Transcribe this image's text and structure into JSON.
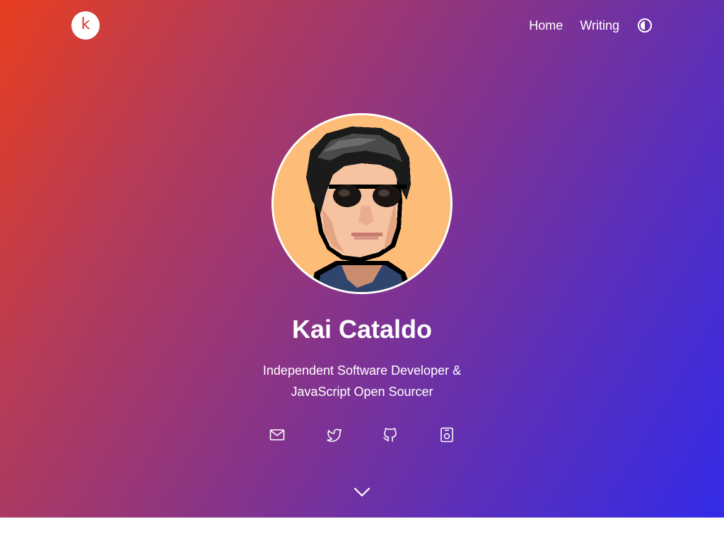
{
  "header": {
    "logo_text": "k",
    "nav": [
      {
        "label": "Home"
      },
      {
        "label": "Writing"
      }
    ],
    "theme_toggle_icon": "half-circle-contrast-icon"
  },
  "profile": {
    "name": "Kai Cataldo",
    "tagline_line1": "Independent Software Developer &",
    "tagline_line2": "JavaScript Open Sourcer",
    "avatar_description": "pixel-art-portrait"
  },
  "socials": [
    {
      "icon": "mail-icon"
    },
    {
      "icon": "twitter-icon"
    },
    {
      "icon": "github-icon"
    },
    {
      "icon": "resume-icon"
    }
  ],
  "scroll_icon": "chevron-down-icon",
  "colors": {
    "gradient_start": "#e83e1e",
    "gradient_mid": "#8b3485",
    "gradient_end": "#332be8",
    "avatar_bg": "#fdbd78",
    "logo_letter": "#d8392b"
  }
}
